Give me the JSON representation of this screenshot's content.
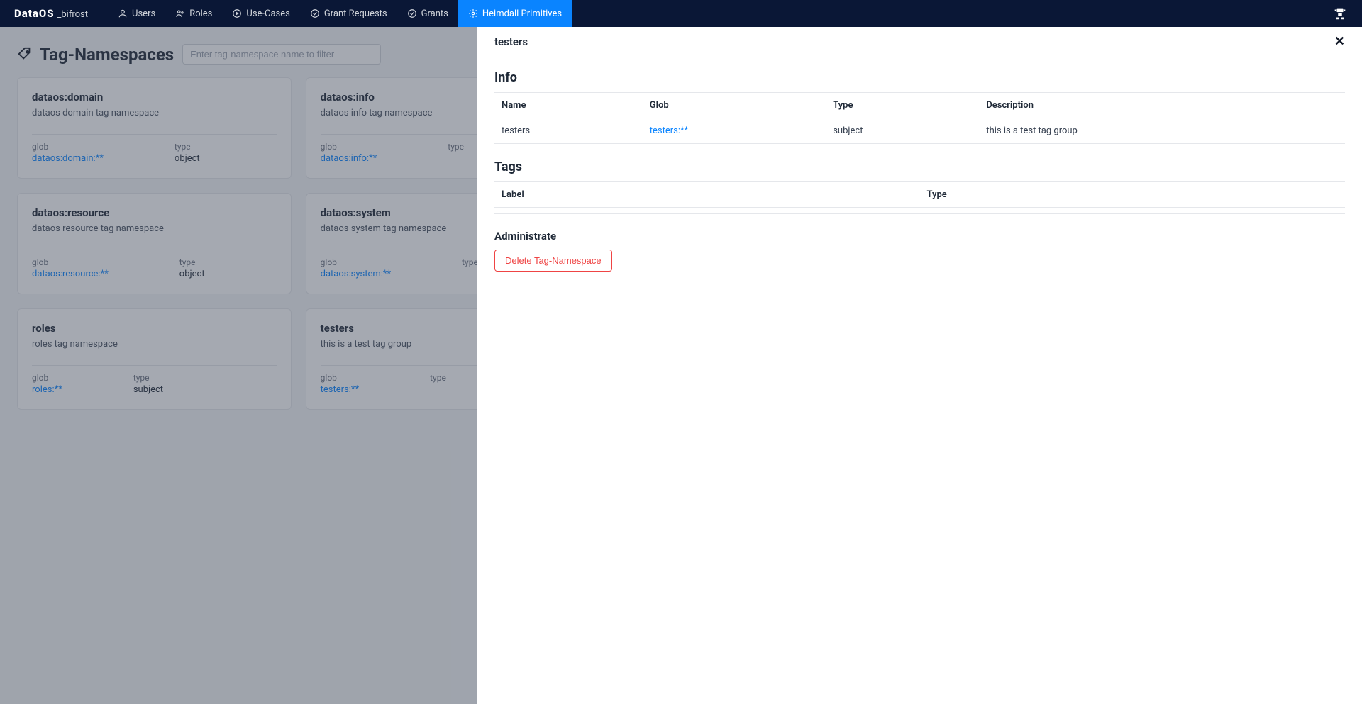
{
  "brand": {
    "logo": "DataOS",
    "sub": "_bifrost"
  },
  "nav": {
    "items": [
      {
        "label": "Users"
      },
      {
        "label": "Roles"
      },
      {
        "label": "Use-Cases"
      },
      {
        "label": "Grant Requests"
      },
      {
        "label": "Grants"
      },
      {
        "label": "Heimdall Primitives"
      }
    ]
  },
  "page": {
    "title": "Tag-Namespaces",
    "filter_placeholder": "Enter tag-namespace name to filter"
  },
  "cards": [
    {
      "name": "dataos:domain",
      "desc": "dataos domain tag namespace",
      "glob_label": "glob",
      "glob": "dataos:domain:**",
      "type_label": "type",
      "type": "object"
    },
    {
      "name": "dataos:info",
      "desc": "dataos info tag namespace",
      "glob_label": "glob",
      "glob": "dataos:info:**",
      "type_label": "type",
      "type": ""
    },
    {
      "name": "",
      "desc": "",
      "glob_label": "",
      "glob": "",
      "type_label": "",
      "type": ""
    },
    {
      "name": "dataos:resource",
      "desc": "dataos resource tag namespace",
      "glob_label": "glob",
      "glob": "dataos:resource:**",
      "type_label": "type",
      "type": "object"
    },
    {
      "name": "dataos:system",
      "desc": "dataos system tag namespace",
      "glob_label": "glob",
      "glob": "dataos:system:**",
      "type_label": "type",
      "type": ""
    },
    {
      "name": "",
      "desc": "",
      "glob_label": "",
      "glob": "",
      "type_label": "",
      "type": ""
    },
    {
      "name": "roles",
      "desc": "roles tag namespace",
      "glob_label": "glob",
      "glob": "roles:**",
      "type_label": "type",
      "type": "subject"
    },
    {
      "name": "testers",
      "desc": "this is a test tag group",
      "glob_label": "glob",
      "glob": "testers:**",
      "type_label": "type",
      "type": ""
    },
    {
      "name": "",
      "desc": "",
      "glob_label": "",
      "glob": "",
      "type_label": "",
      "type": ""
    }
  ],
  "panel": {
    "title": "testers",
    "info": {
      "heading": "Info",
      "headers": {
        "name": "Name",
        "glob": "Glob",
        "type": "Type",
        "desc": "Description"
      },
      "row": {
        "name": "testers",
        "glob": "testers:**",
        "type": "subject",
        "desc": "this is a test tag group"
      }
    },
    "tags": {
      "heading": "Tags",
      "headers": {
        "label": "Label",
        "type": "Type"
      }
    },
    "admin": {
      "heading": "Administrate",
      "delete_label": "Delete Tag-Namespace"
    }
  }
}
